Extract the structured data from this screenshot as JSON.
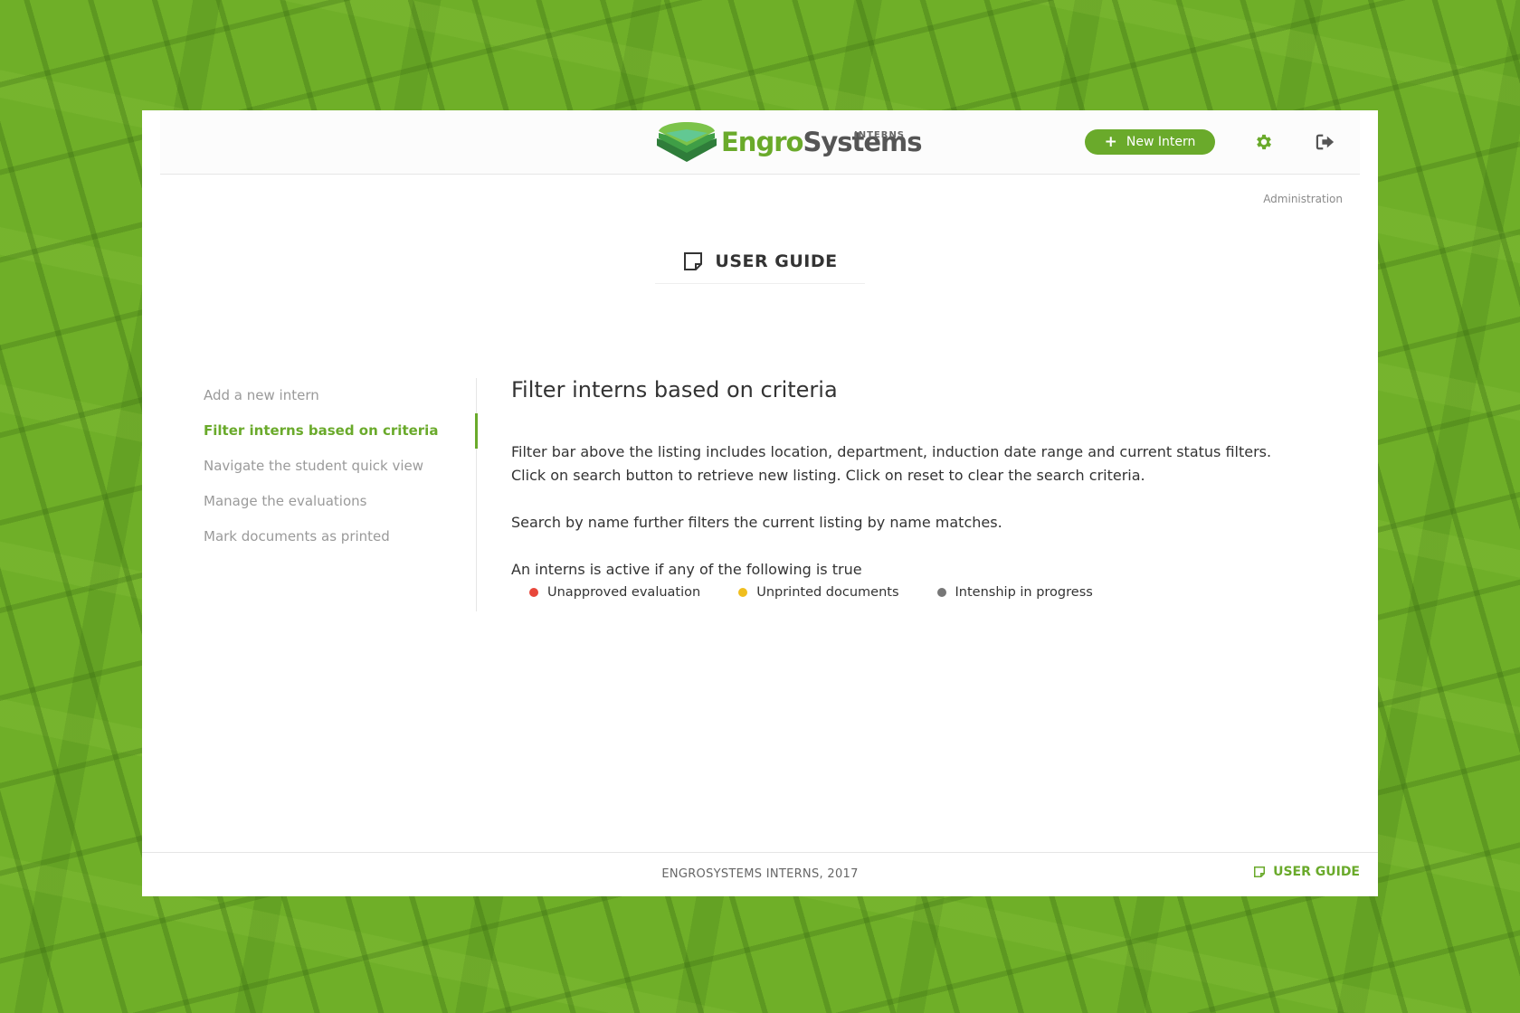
{
  "brand": {
    "name_part1": "Engro",
    "name_part2": "Systems",
    "subtitle": "INTERNS"
  },
  "header": {
    "new_button_label": "New Intern",
    "new_button_icon": "plus-icon",
    "settings_icon": "gear-icon",
    "logout_icon": "logout-icon",
    "admin_link": "Administration"
  },
  "page": {
    "title": "USER GUIDE",
    "title_icon": "note-icon"
  },
  "sidebar": {
    "items": [
      {
        "label": "Add a new intern",
        "active": false
      },
      {
        "label": "Filter interns based on criteria",
        "active": true
      },
      {
        "label": "Navigate the student quick view",
        "active": false
      },
      {
        "label": "Manage the evaluations",
        "active": false
      },
      {
        "label": "Mark documents as printed",
        "active": false
      }
    ]
  },
  "content": {
    "heading": "Filter interns based on criteria",
    "paragraph1_line1": "Filter bar above the listing includes location, department, induction date range and current status filters.",
    "paragraph1_line2": "Click on search button to retrieve new listing. Click on reset to clear the search criteria.",
    "paragraph2": "Search by name further filters the current listing by name matches.",
    "paragraph3": "An interns is active if any of the following is true",
    "legend": [
      {
        "label": "Unapproved evaluation",
        "color": "#e8473b"
      },
      {
        "label": "Unprinted documents",
        "color": "#f0be1e"
      },
      {
        "label": "Intenship in progress",
        "color": "#777777"
      }
    ]
  },
  "footer": {
    "copyright": "ENGROSYSTEMS INTERNS, 2017",
    "guide_link": "USER GUIDE",
    "guide_icon": "note-icon"
  },
  "colors": {
    "accent": "#6aaa2b",
    "background": "#6faf28"
  }
}
